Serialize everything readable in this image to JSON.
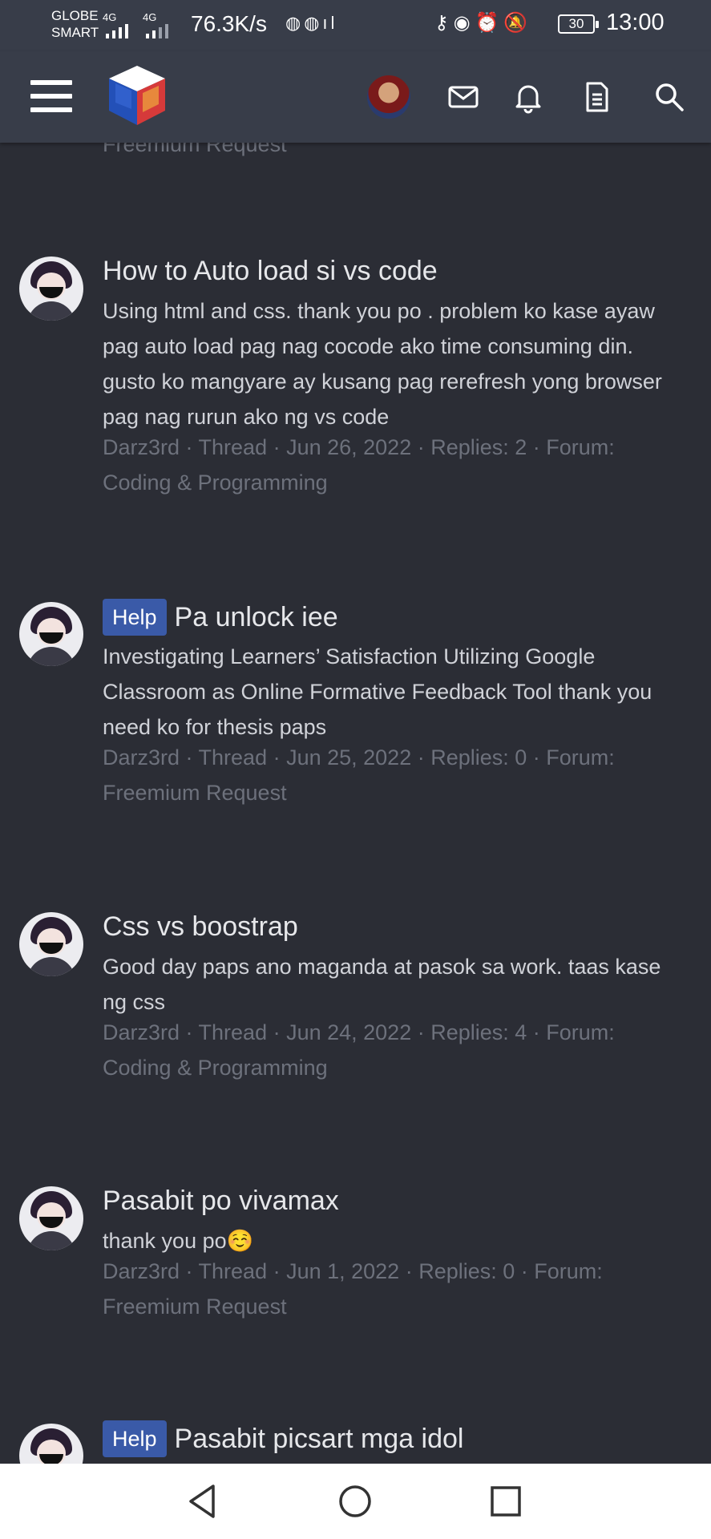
{
  "status_bar": {
    "carrier_1": "GLOBE",
    "carrier_2": "SMART",
    "signal_1": "4G",
    "signal_2": "4G",
    "net_speed": "76.3K/s",
    "battery": "30",
    "time": "13:00"
  },
  "header": {
    "menu_icon": "hamburger-icon",
    "logo_icon": "cube-logo",
    "avatar_icon": "user-avatar",
    "icons": [
      "envelope-icon",
      "bell-icon",
      "document-icon",
      "search-icon"
    ]
  },
  "partial_top": {
    "meta_line": "Freemium Request"
  },
  "threads": [
    {
      "prefix": "",
      "title": "How to Auto load si vs code",
      "snippet": "Using html and css. thank you po . problem ko kase ayaw pag auto load pag nag cocode ako time consuming din. gusto ko mangyare ay kusang pag rerefresh yong browser pag nag rurun ako ng vs code",
      "meta": "Darz3rd · Thread · Jun 26, 2022 · Replies: 2 · Forum: Coding & Programming"
    },
    {
      "prefix": "Help",
      "title": "Pa unlock iee",
      "snippet": "Investigating Learners’ Satisfaction Utilizing Google Classroom as Online Formative Feedback Tool thank you need ko for thesis paps",
      "meta": "Darz3rd · Thread · Jun 25, 2022 · Replies: 0 · Forum: Freemium Request"
    },
    {
      "prefix": "",
      "title": "Css vs boostrap",
      "snippet": "Good day paps ano maganda at pasok sa work. taas kase ng css",
      "meta": "Darz3rd · Thread · Jun 24, 2022 · Replies: 4 · Forum: Coding & Programming"
    },
    {
      "prefix": "",
      "title": "Pasabit po vivamax",
      "snippet": "thank you po☺️",
      "meta": "Darz3rd · Thread · Jun 1, 2022 · Replies: 0 · Forum: Freemium Request"
    },
    {
      "prefix": "Help",
      "title": "Pasabit picsart mga idol",
      "snippet": "",
      "meta": ""
    }
  ],
  "nav_bar": {
    "icons": [
      "back-icon",
      "home-icon",
      "recents-icon"
    ]
  },
  "colors": {
    "background": "#2b2d35",
    "bar": "#383d49",
    "prefix_bg": "#3a5aa8",
    "meta_text": "#6d717c"
  }
}
